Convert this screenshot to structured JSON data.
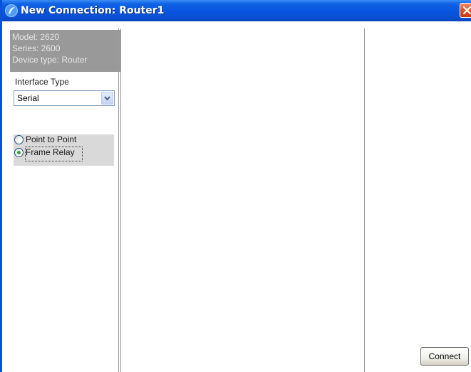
{
  "window": {
    "title": "New Connection: Router1"
  },
  "device": {
    "model": "Model: 2620",
    "series": "Series: 2600",
    "device_type": "Device type: Router"
  },
  "interface": {
    "label": "Interface Type",
    "selected": "Serial"
  },
  "connection_mode": {
    "options": [
      {
        "label": "Point to Point",
        "selected": false
      },
      {
        "label": "Frame Relay",
        "selected": true
      }
    ]
  },
  "actions": {
    "connect_label": "Connect"
  },
  "colors": {
    "titlebar": "#0a55de",
    "close_button": "#e2522a",
    "device_info_bg": "#999999",
    "radio_group_bg": "#d9d9d9"
  },
  "icons": {
    "title": "app-swirl-icon",
    "close": "close-icon",
    "dropdown": "chevron-down-icon"
  }
}
